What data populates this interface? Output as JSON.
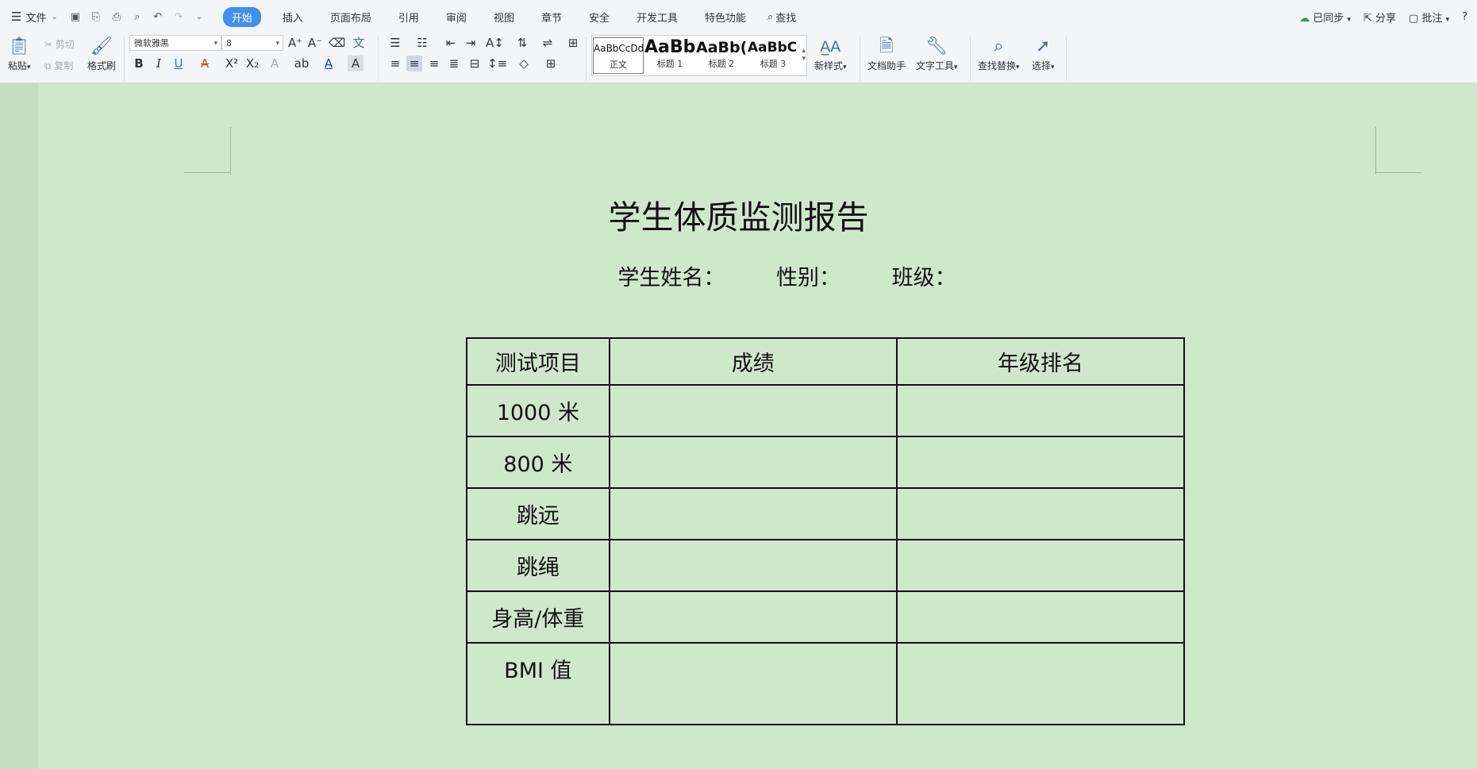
{
  "menubar": {
    "file_label": "文件",
    "tabs": [
      {
        "label": "开始",
        "active": true
      },
      {
        "label": "插入"
      },
      {
        "label": "页面布局"
      },
      {
        "label": "引用"
      },
      {
        "label": "审阅"
      },
      {
        "label": "视图"
      },
      {
        "label": "章节"
      },
      {
        "label": "安全"
      },
      {
        "label": "开发工具"
      },
      {
        "label": "特色功能"
      }
    ],
    "search_label": "查找",
    "sync_label": "已同步",
    "share_label": "分享",
    "comment_label": "批注",
    "help_label": "?"
  },
  "ribbon": {
    "paste_label": "粘贴",
    "cut_label": "剪切",
    "copy_label": "复制",
    "format_painter_label": "格式刷",
    "font_name": "微软雅黑",
    "font_size": "8",
    "styles": [
      {
        "preview": "AaBbCcDd",
        "name": "正文"
      },
      {
        "preview": "AaBb",
        "name": "标题 1"
      },
      {
        "preview": "AaBb(",
        "name": "标题 2"
      },
      {
        "preview": "AaBbC(",
        "name": "标题 3"
      }
    ],
    "new_style_label": "新样式",
    "doc_helper_label": "文档助手",
    "text_tools_label": "文字工具",
    "find_replace_label": "查找替换",
    "select_label": "选择"
  },
  "document": {
    "title": "学生体质监测报告",
    "fields": [
      "学生姓名：",
      "性别：",
      "班级："
    ],
    "table": {
      "headers": [
        "测试项目",
        "成绩",
        "年级排名"
      ],
      "rows": [
        [
          "1000 米",
          "",
          ""
        ],
        [
          "800 米",
          "",
          ""
        ],
        [
          "跳远",
          "",
          ""
        ],
        [
          "跳绳",
          "",
          ""
        ],
        [
          "身高/体重",
          "",
          ""
        ],
        [
          "BMI 值",
          "",
          ""
        ]
      ]
    }
  },
  "colors": {
    "accent": "#3f8ef0",
    "page_bg": "#cfe8cb"
  }
}
